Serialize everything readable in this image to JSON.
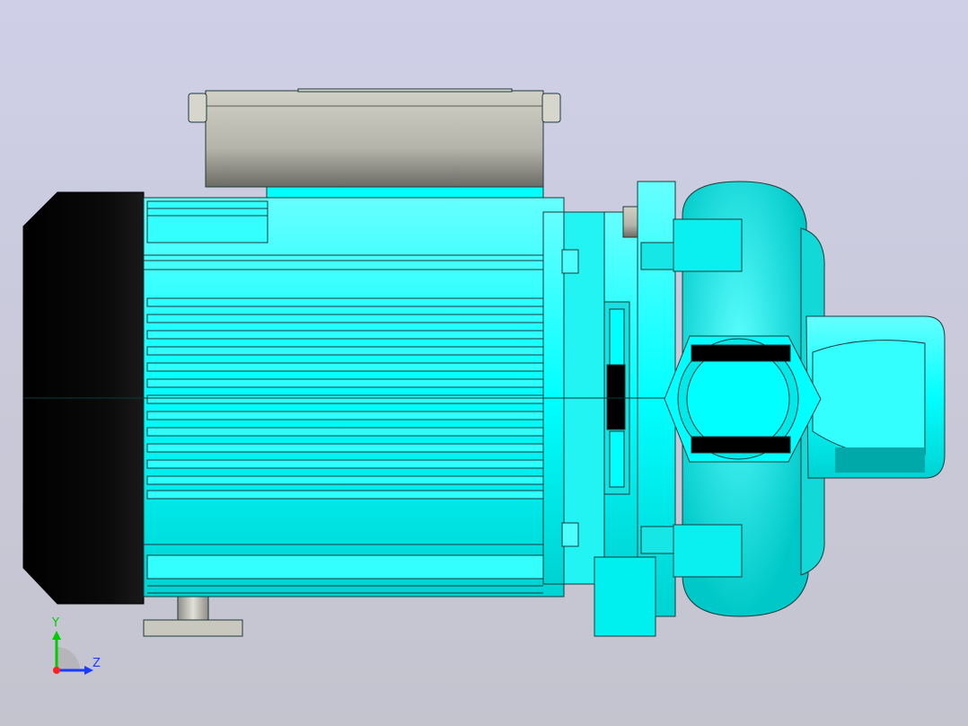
{
  "viewport": {
    "background_top": "#cfcfe8",
    "background_bottom": "#c4c4cf"
  },
  "model": {
    "body_color": "#00ffff",
    "fan_cover_color": "#050505",
    "terminal_box_color": "#c8c8bc",
    "foot_color": "#b8b8ae"
  },
  "triad": {
    "y_label": "Y",
    "z_label": "Z",
    "y_color": "#00cc00",
    "z_color": "#1a3cff",
    "x_color": "#ff2020"
  }
}
